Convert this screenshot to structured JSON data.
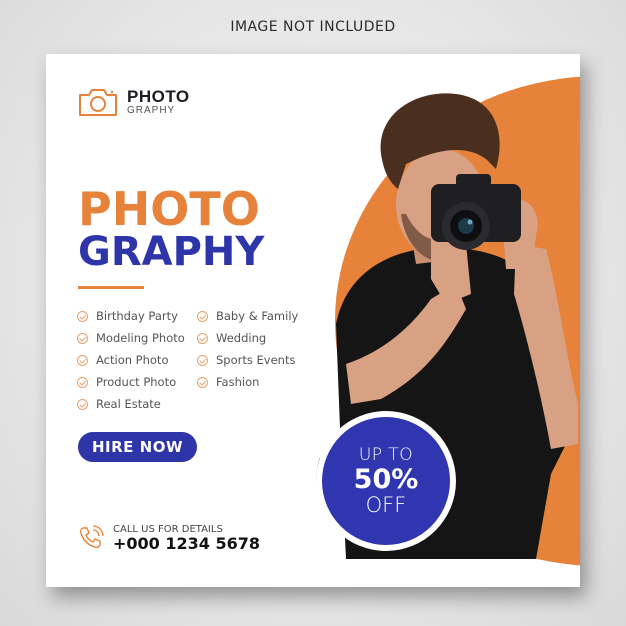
{
  "watermark": "IMAGE NOT INCLUDED",
  "colors": {
    "accent_orange": "#e7823a",
    "accent_blue": "#2e35a8"
  },
  "logo": {
    "icon": "camera-icon",
    "title": "PHOTO",
    "subtitle": "GRAPHY"
  },
  "headline": {
    "line1": "PHOTO",
    "line2": "GRAPHY"
  },
  "services": {
    "left": [
      "Birthday Party",
      "Modeling Photo",
      "Action Photo",
      "Product Photo",
      "Real Estate"
    ],
    "right": [
      "Baby & Family",
      "Wedding",
      "Sports Events",
      "Fashion"
    ]
  },
  "cta": {
    "label": "HIRE NOW"
  },
  "contact": {
    "icon": "phone-icon",
    "label": "CALL US FOR DETAILS",
    "number": "+000 1234 5678"
  },
  "offer": {
    "top": "UP TO",
    "value": "50%",
    "bottom": "OFF"
  },
  "photo": {
    "subject": "man holding camera"
  }
}
